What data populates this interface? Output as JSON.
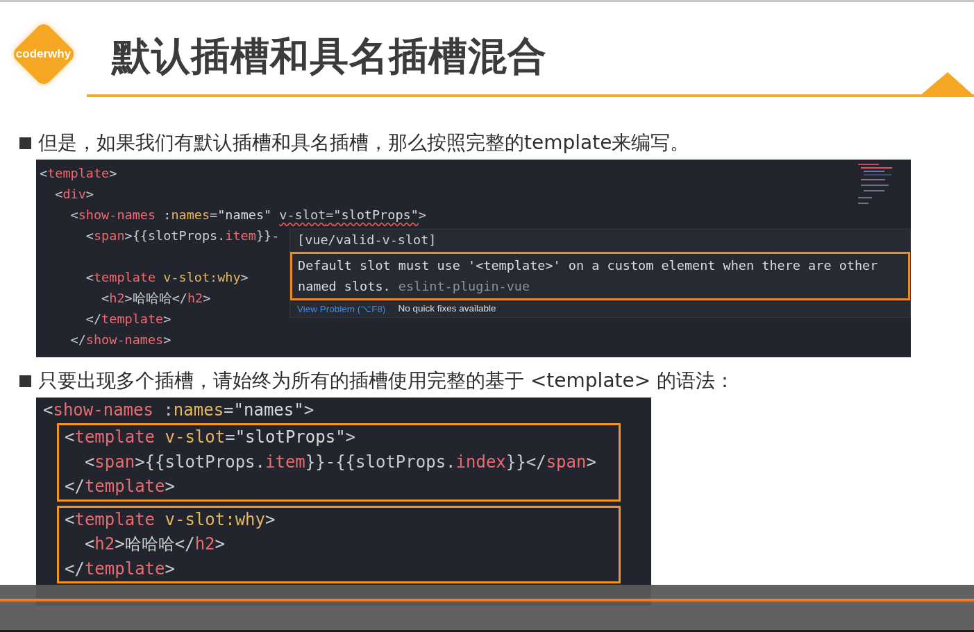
{
  "logo": {
    "text": "coderwhy"
  },
  "title": "默认插槽和具名插槽混合",
  "sections": [
    {
      "bullet": "但是，如果我们有默认插槽和具名插槽，那么按照完整的template来编写。",
      "code": {
        "kind": "editor",
        "paragraphs": [
          [
            {
              "text": "<template>"
            },
            {
              "text": "  <div>"
            },
            {
              "text": "    <show-names :names=\"names\" ",
              "flagged": "v-slot=\"slotProps\"",
              "rest": ">"
            },
            {
              "text": "      <span>{{slotProps.item}}-"
            }
          ],
          [
            {
              "text": "      <template v-slot:why>"
            },
            {
              "text": "        <h2>哈哈哈</h2>"
            },
            {
              "text": "      </template>"
            },
            {
              "text": "    </show-names>"
            }
          ]
        ],
        "tooltip": {
          "rule": "[vue/valid-v-slot]",
          "message": "Default slot must use '<template>' on a custom element when there are other named slots.",
          "source": "eslint-plugin-vue",
          "link": "View Problem (⌥F8)",
          "note": "No quick fixes available"
        }
      }
    },
    {
      "bullet": "只要出现多个插槽，请始终为所有的插槽使用完整的基于 <template> 的语法：",
      "code": {
        "kind": "snippet",
        "blocks": [
          {
            "highlighted": false,
            "lines": [
              {
                "text": "<show-names :names=\"names\">"
              }
            ]
          },
          {
            "highlighted": true,
            "lines": [
              {
                "text": "<template v-slot=\"slotProps\">"
              },
              {
                "text": "  <span>{{slotProps.item}}-{{slotProps.index}}</span>"
              },
              {
                "text": "</template>"
              }
            ]
          },
          {
            "highlighted": true,
            "lines": [
              {
                "text": "<template v-slot:why>"
              },
              {
                "text": "  <h2>哈哈哈</h2>"
              },
              {
                "text": "</template>"
              }
            ]
          }
        ]
      }
    }
  ],
  "player": {
    "level": 1
  }
}
